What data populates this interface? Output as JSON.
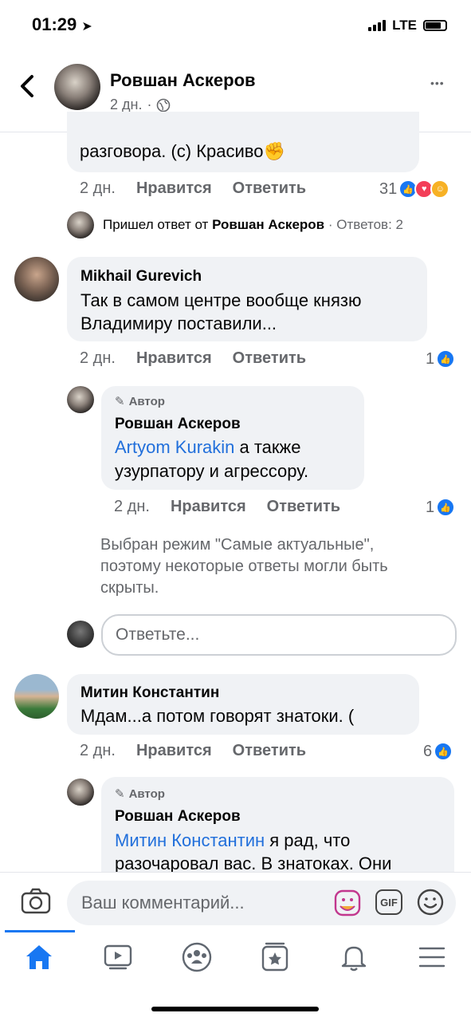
{
  "status_bar": {
    "time": "01:29",
    "network": "LTE"
  },
  "header": {
    "back_label": "‹",
    "title": "Ровшан Аскеров",
    "age": "2 дн.",
    "dot": "·",
    "more_label": "•••"
  },
  "top_comment": {
    "text_tail": "разговора. (с) Красиво",
    "emoji": "✊",
    "time": "2 дн.",
    "like": "Нравится",
    "reply": "Ответить",
    "reaction_count": "31"
  },
  "replies_summary": {
    "prefix": "Пришел ответ от",
    "author": "Ровшан Аскеров",
    "sep": "·",
    "count_text": "Ответов: 2"
  },
  "comment1": {
    "author": "Mikhail Gurevich",
    "line1": "Так в самом центре вообще князю",
    "line2": "Владимиру поставили...",
    "time": "2 дн.",
    "like": "Нравится",
    "reply": "Ответить",
    "reaction_count": "1"
  },
  "reply1": {
    "badge": "Автор",
    "author": "Ровшан Аскеров",
    "mention": "Artyom Kurakin",
    "text1": " а также",
    "text2": "узурпатору и агрессору.",
    "time": "2 дн.",
    "like": "Нравится",
    "reply": "Ответить",
    "reaction_count": "1"
  },
  "notice": {
    "line1": "Выбран режим \"Самые актуальные\",",
    "line2": "поэтому некоторые ответы могли быть",
    "line3": "скрыты."
  },
  "reply_input": {
    "placeholder": "Ответьте..."
  },
  "comment2": {
    "author": "Митин Константин",
    "text": "Мдам...а потом говорят знатоки. (",
    "time": "2 дн.",
    "like": "Нравится",
    "reply": "Ответить",
    "reaction_count": "6"
  },
  "reply2": {
    "badge": "Автор",
    "author": "Ровшан Аскеров",
    "mention": "Митин Константин",
    "text1": " я рад, что",
    "text2": "разочаровал вас. В знатоках. Они"
  },
  "composer": {
    "placeholder": "Ваш комментарий...",
    "gif": "GIF"
  },
  "nav": [
    "home-icon",
    "watch-icon",
    "groups-icon",
    "pages-icon",
    "bell-icon",
    "menu-icon"
  ],
  "colors": {
    "accent": "#1877f2",
    "link": "#216fdb",
    "bubble": "#f0f2f5",
    "meta": "#65676b"
  }
}
